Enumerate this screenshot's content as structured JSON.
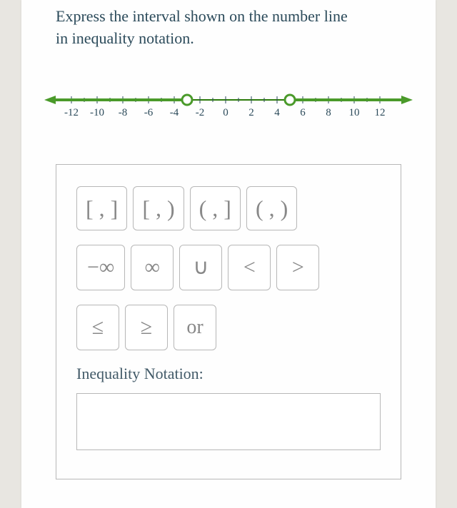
{
  "prompt": "Express the interval shown on the number line in inequality notation.",
  "numberline": {
    "ticks": [
      "-12",
      "-10",
      "-8",
      "-6",
      "-4",
      "-2",
      "0",
      "2",
      "4",
      "6",
      "8",
      "10",
      "12"
    ],
    "openPoints": [
      -3,
      5
    ],
    "lineColor": "#4a9a2a",
    "pointFill": "#ffffff",
    "pointStroke": "#4a9a2a"
  },
  "buttons": {
    "row1": [
      "[ , ]",
      "[ , )",
      "( , ]",
      "( , )"
    ],
    "row2": [
      "−∞",
      "∞",
      "∪",
      "<",
      ">"
    ],
    "row3": [
      "≤",
      "≥",
      "or"
    ]
  },
  "notationLabel": "Inequality Notation:"
}
